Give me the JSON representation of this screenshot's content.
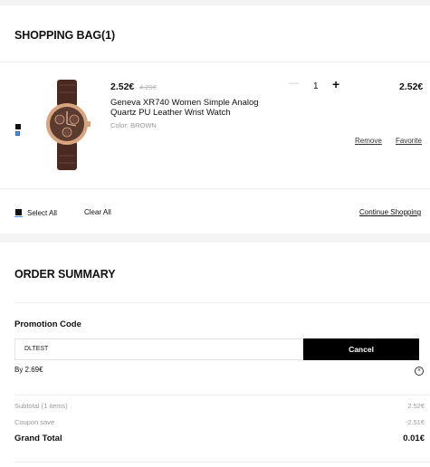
{
  "bag": {
    "title": "SHOPPING BAG(1)",
    "item": {
      "price": "2.52€",
      "old_price": "4.29€",
      "name": "Geneva XR740 Women Simple Analog Quartz PU Leather Wrist Watch",
      "color": "Color: BROWN",
      "quantity": "1",
      "minus": "—",
      "plus": "+",
      "total": "2.52€",
      "remove_label": "Remove",
      "favorite_label": "Favorite"
    },
    "select_all": "Select All",
    "clear_all": "Clear All",
    "continue_shopping": "Continue Shopping"
  },
  "summary": {
    "title": "ORDER SUMMARY",
    "promo_title": "Promotion Code",
    "promo_value": "DLTEST",
    "cancel_label": "Cancel",
    "promo_saving": "By 2.69€",
    "subtotal_label": "Subtotal (1 items)",
    "subtotal_value": "2.52€",
    "coupon_label": "Coupon save",
    "coupon_value": "-2.51€",
    "grand_total_label": "Grand Total",
    "grand_total_value": "0.01€"
  },
  "colors": {
    "accent": "#000000",
    "checkbox_blue": "#4a90e2",
    "strap": "#4a2a20",
    "case_gold": "#d9a57e"
  }
}
